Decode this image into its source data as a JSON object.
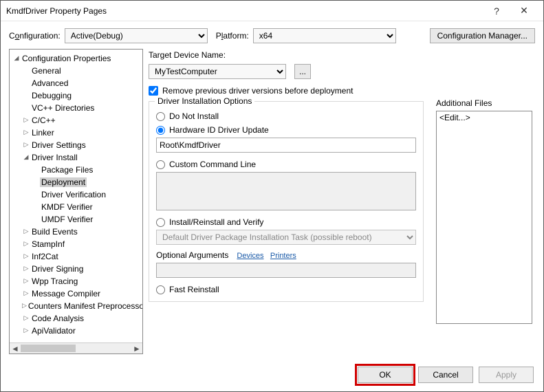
{
  "window": {
    "title": "KmdfDriver Property Pages",
    "help": "?",
    "close": "✕"
  },
  "topbar": {
    "config_label_pre": "C",
    "config_label_u": "o",
    "config_label_post": "nfiguration:",
    "config_value": "Active(Debug)",
    "platform_label_pre": "P",
    "platform_label_u": "l",
    "platform_label_post": "atform:",
    "platform_value": "x64",
    "cfgmgr": "Configuration Manager..."
  },
  "tree": [
    {
      "lvl": 0,
      "tw": "exp",
      "label": "Configuration Properties"
    },
    {
      "lvl": 1,
      "tw": "",
      "label": "General"
    },
    {
      "lvl": 1,
      "tw": "",
      "label": "Advanced"
    },
    {
      "lvl": 1,
      "tw": "",
      "label": "Debugging"
    },
    {
      "lvl": 1,
      "tw": "",
      "label": "VC++ Directories"
    },
    {
      "lvl": 1,
      "tw": "col",
      "label": "C/C++"
    },
    {
      "lvl": 1,
      "tw": "col",
      "label": "Linker"
    },
    {
      "lvl": 1,
      "tw": "col",
      "label": "Driver Settings"
    },
    {
      "lvl": 1,
      "tw": "exp",
      "label": "Driver Install"
    },
    {
      "lvl": 2,
      "tw": "",
      "label": "Package Files"
    },
    {
      "lvl": 2,
      "tw": "",
      "label": "Deployment",
      "sel": true
    },
    {
      "lvl": 2,
      "tw": "",
      "label": "Driver Verification"
    },
    {
      "lvl": 2,
      "tw": "",
      "label": "KMDF Verifier"
    },
    {
      "lvl": 2,
      "tw": "",
      "label": "UMDF Verifier"
    },
    {
      "lvl": 1,
      "tw": "col",
      "label": "Build Events"
    },
    {
      "lvl": 1,
      "tw": "col",
      "label": "StampInf"
    },
    {
      "lvl": 1,
      "tw": "col",
      "label": "Inf2Cat"
    },
    {
      "lvl": 1,
      "tw": "col",
      "label": "Driver Signing"
    },
    {
      "lvl": 1,
      "tw": "col",
      "label": "Wpp Tracing"
    },
    {
      "lvl": 1,
      "tw": "col",
      "label": "Message Compiler"
    },
    {
      "lvl": 1,
      "tw": "col",
      "label": "Counters Manifest Preprocessor"
    },
    {
      "lvl": 1,
      "tw": "col",
      "label": "Code Analysis"
    },
    {
      "lvl": 1,
      "tw": "col",
      "label": "ApiValidator"
    }
  ],
  "right": {
    "target_label": "Target Device Name:",
    "target_value": "MyTestComputer",
    "browse": "...",
    "remove_prev": "Remove previous driver versions before deployment",
    "groupbox_legend": "Driver Installation Options",
    "opt_noinstall": "Do Not Install",
    "opt_hwid": "Hardware ID Driver Update",
    "hwid_value": "Root\\KmdfDriver",
    "opt_custom": "Custom Command Line",
    "opt_install": "Install/Reinstall and Verify",
    "install_task": "Default Driver Package Installation Task (possible reboot)",
    "optargs_label": "Optional Arguments",
    "link_devices": "Devices",
    "link_printers": "Printers",
    "opt_fast": "Fast Reinstall",
    "addfiles_label": "Additional Files",
    "addfiles_item": "<Edit...>"
  },
  "footer": {
    "ok": "OK",
    "cancel": "Cancel",
    "apply": "Apply"
  }
}
